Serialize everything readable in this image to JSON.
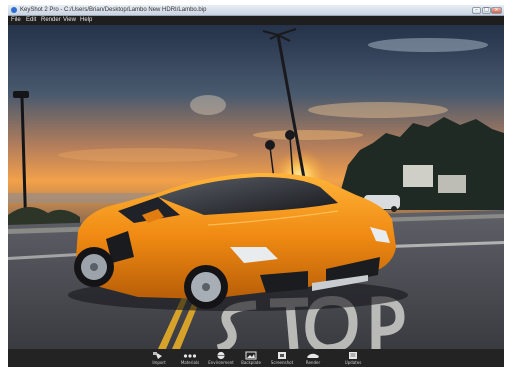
{
  "window": {
    "title": "KeyShot 2 Pro - C:/Users/Brian/Desktop/Lambo New HDRI/Lambo.bip"
  },
  "menu": [
    "File",
    "Edit",
    "Render",
    "View",
    "Help"
  ],
  "toolbar": [
    "Import",
    "Materials",
    "Environment",
    "Backplate",
    "Screenshot",
    "Render",
    "Updates"
  ],
  "colors": {
    "car_body": "#f08a12",
    "chrome": "#2b2b2b",
    "sky_top": "#2b3a55",
    "sunset": "#f2a14a"
  }
}
